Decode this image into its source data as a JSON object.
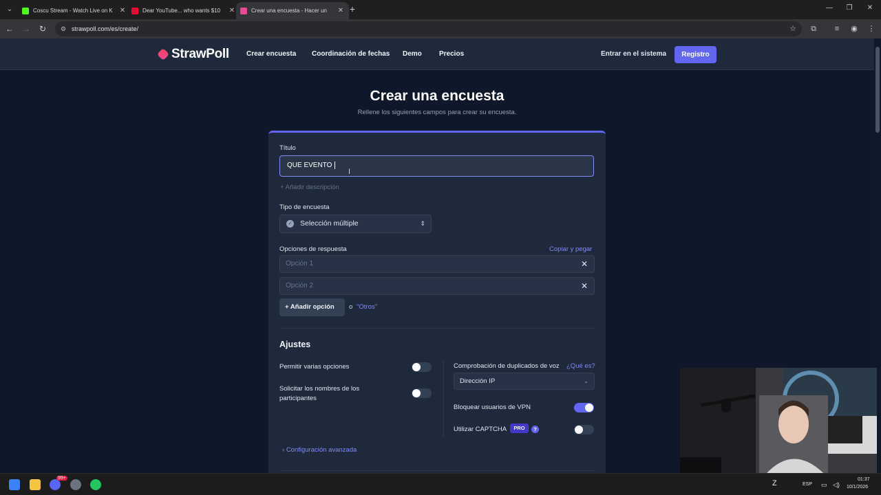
{
  "browser": {
    "tabs": [
      {
        "title": "Coscu Stream - Watch Live on K",
        "color": "#53fc18"
      },
      {
        "title": "Dear YouTube... who wants $10",
        "color": "#ff0033"
      },
      {
        "title": "Crear una encuesta - Hacer un",
        "color": "#ec4899"
      }
    ],
    "url": "strawpoll.com/es/create/"
  },
  "nav": {
    "logo": "StrawPoll",
    "links": [
      "Crear encuesta",
      "Coordinación de fechas",
      "Demo",
      "Precios"
    ],
    "login": "Entrar en el sistema",
    "signup": "Registro"
  },
  "page": {
    "title": "Crear una encuesta",
    "subtitle": "Rellene los siguientes campos para crear su encuesta."
  },
  "form": {
    "title_label": "Título",
    "title_value": "QUE EVENTO ",
    "add_description": "Añadir descripción",
    "poll_type_label": "Tipo de encuesta",
    "poll_type_value": "Selección múltiple",
    "answers_label": "Opciones de respuesta",
    "copy_paste": "Copiar y pegar",
    "options": [
      {
        "placeholder": "Opción 1"
      },
      {
        "placeholder": "Opción 2"
      }
    ],
    "add_option": "Añadir opción",
    "or": "o",
    "other": "\"Otros\""
  },
  "settings": {
    "heading": "Ajustes",
    "allow_multiple": {
      "label": "Permitir varias opciones",
      "on": false
    },
    "require_names": {
      "label": "Solicitar los nombres de los participantes",
      "on": false
    },
    "dup_check_label": "Comprobación de duplicados de voz",
    "what_is": "¿Qué es?",
    "dup_check_value": "Dirección IP",
    "block_vpn": {
      "label": "Bloquear usuarios de VPN",
      "on": true
    },
    "captcha": {
      "label": "Utilizar CAPTCHA",
      "badge": "PRO",
      "on": false
    },
    "advanced": "Configuración avanzada"
  },
  "taskbar": {
    "lang": "ESP",
    "time": "01:37",
    "date": "10/1/2026",
    "badge": "99+"
  },
  "colors": {
    "accent": "#6366f1",
    "bg": "#0f172a",
    "card": "#1e293b"
  }
}
